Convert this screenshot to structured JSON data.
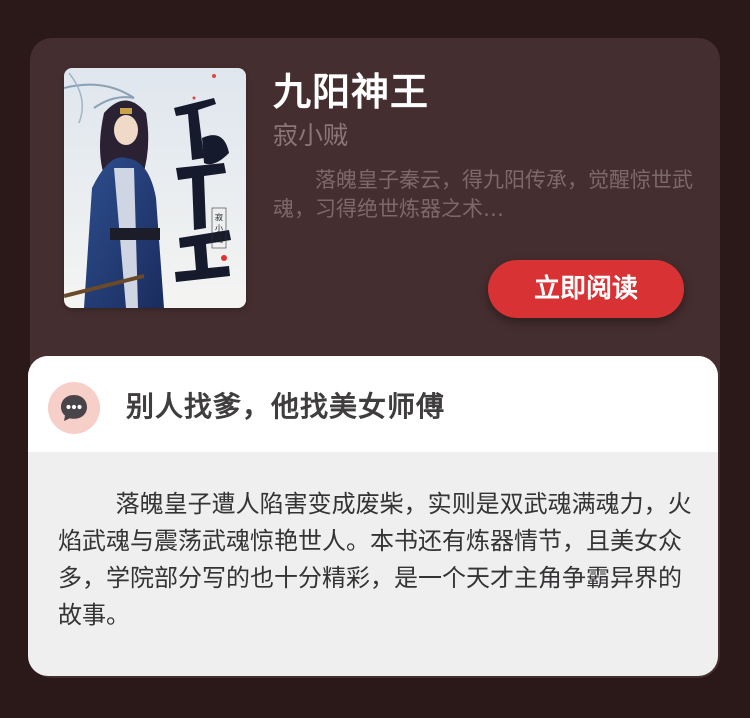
{
  "book": {
    "title": "九阳神王",
    "author": "寂小贼",
    "description": "落魄皇子秦云，得九阳传承，觉醒惊世武魂，习得绝世炼器之术…",
    "cover_title_text": "九阳神王",
    "cover_author_text": "寂小贼"
  },
  "actions": {
    "read_now_label": "立即阅读"
  },
  "review": {
    "icon": "chat-bubble-icon",
    "title": "别人找爹，他找美女师傅",
    "body": "落魄皇子遭人陷害变成废柴，实则是双武魂满魂力，火焰武魂与震荡武魂惊艳世人。本书还有炼器情节，且美女众多，学院部分写的也十分精彩，是一个天才主角争霸异界的故事。"
  },
  "colors": {
    "page_bg": "#2b1819",
    "card_bg": "#452e2f",
    "accent_red": "#d93235",
    "review_bg": "#efefef",
    "icon_circle": "#f6cfc8",
    "icon_bubble": "#494449"
  }
}
